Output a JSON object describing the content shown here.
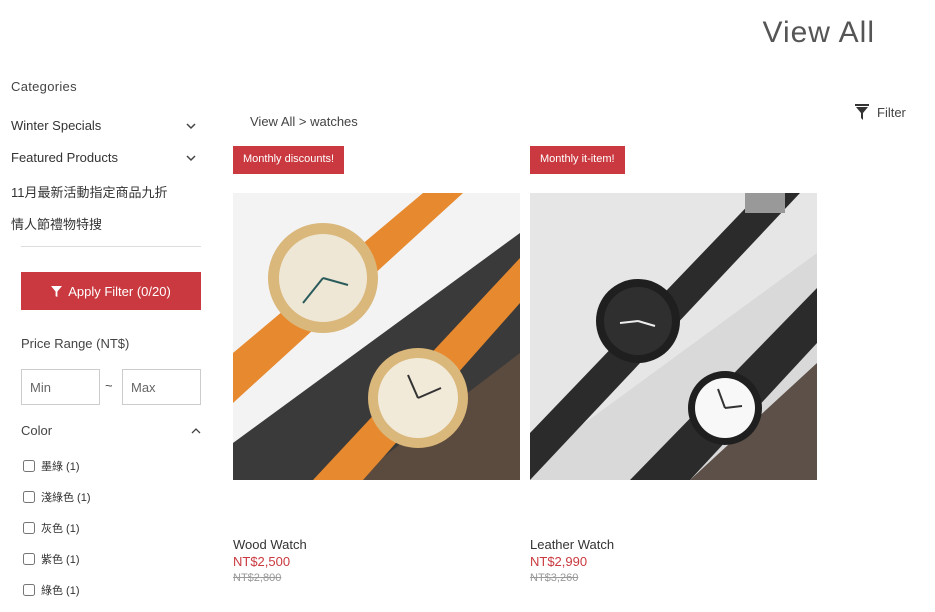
{
  "page_title": "View All",
  "sidebar": {
    "categories_heading": "Categories",
    "categories": [
      {
        "label": "Winter Specials"
      },
      {
        "label": "Featured Products"
      },
      {
        "label": "11月最新活動指定商品九折"
      },
      {
        "label": "情人節禮物特搜"
      }
    ],
    "apply_filter_label": "Apply Filter (0/20)",
    "price_range_label": "Price Range (NT$)",
    "price_min_placeholder": "Min",
    "price_max_placeholder": "Max",
    "price_separator": "~",
    "color_heading": "Color",
    "colors": [
      {
        "label": "墨綠 (1)"
      },
      {
        "label": "淺綠色 (1)"
      },
      {
        "label": "灰色 (1)"
      },
      {
        "label": "紫色 (1)"
      },
      {
        "label": "綠色 (1)"
      }
    ]
  },
  "breadcrumb": "View All > watches",
  "filter_label": "Filter",
  "products": [
    {
      "badge": "Monthly discounts!",
      "name": "Wood Watch",
      "price": "NT$2,500",
      "original_price": "NT$2,800"
    },
    {
      "badge": "Monthly it-item!",
      "name": "Leather Watch",
      "price": "NT$2,990",
      "original_price": "NT$3,260"
    }
  ],
  "accent_color": "#c9393f"
}
